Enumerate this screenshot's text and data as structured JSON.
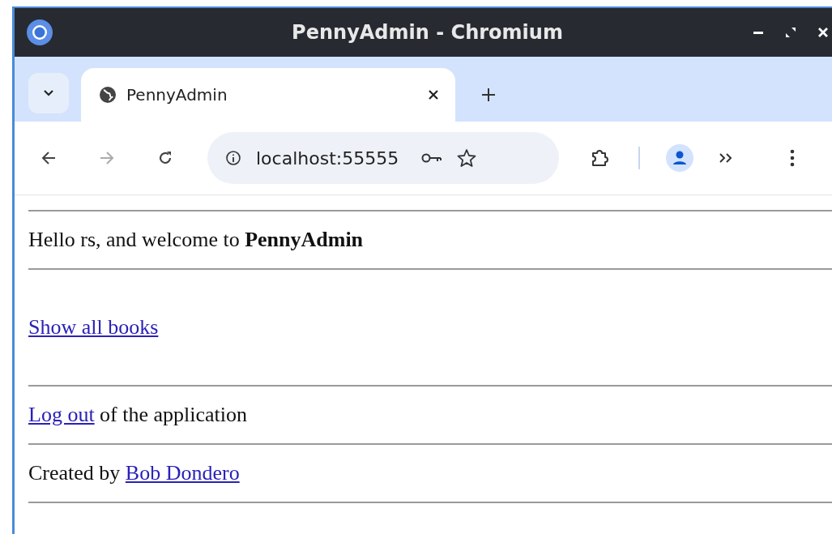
{
  "window": {
    "title": "PennyAdmin - Chromium"
  },
  "tabs": [
    {
      "label": "PennyAdmin",
      "selected": true
    }
  ],
  "address_bar": {
    "value": "localhost:55555"
  },
  "page": {
    "greeting": "Hello rs, and welcome to **PennyAdmin**",
    "books_link": "Show all books",
    "logout": {
      "link": "Log out",
      "text": "of the application"
    },
    "credit": {
      "text": "Created by",
      "link": "Bob Dondero"
    }
  }
}
